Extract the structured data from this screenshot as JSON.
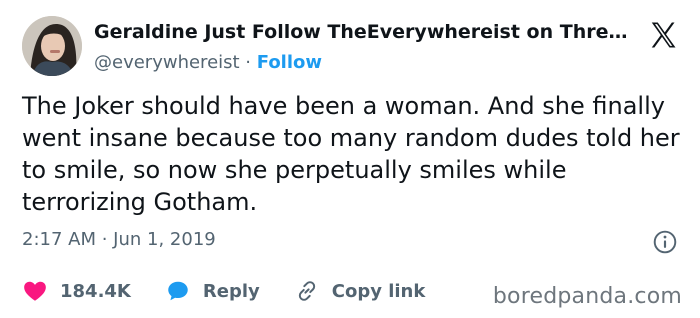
{
  "author": {
    "display_name": "Geraldine Just Follow TheEverywhereist on Thre…",
    "handle": "@everywhereist",
    "separator": " · ",
    "follow_label": "Follow"
  },
  "tweet": {
    "text": "The Joker should have been a woman. And she finally went insane because too many random dudes told her to smile, so now she perpetually smiles while terrorizing Gotham.",
    "time": "2:17 AM",
    "meta_separator": " · ",
    "date": "Jun 1, 2019"
  },
  "actions": {
    "like_count": "184.4K",
    "reply_label": "Reply",
    "copy_link_label": "Copy link"
  },
  "icons": {
    "logo": "x-logo-icon",
    "info": "info-icon",
    "like": "heart-icon",
    "reply": "speech-bubble-icon",
    "copy": "link-icon"
  },
  "colors": {
    "like": "#f91880",
    "reply": "#1d9bf0",
    "follow": "#1d9bf0",
    "muted": "#536471"
  },
  "watermark": "boredpanda.com"
}
